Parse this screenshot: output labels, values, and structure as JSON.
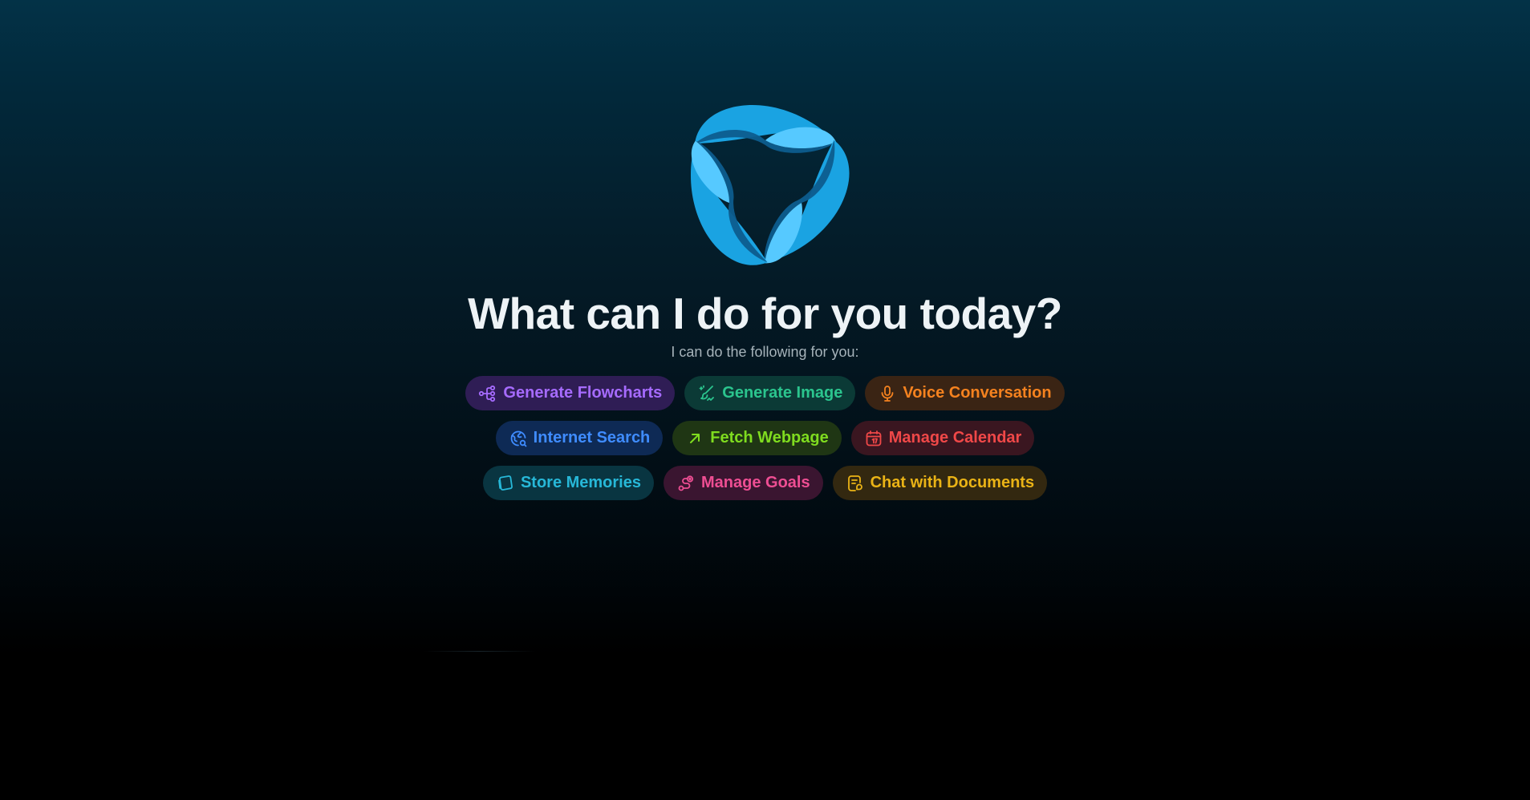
{
  "main": {
    "headline": "What can I do for you today?",
    "subtitle": "I can do the following for you:"
  },
  "chips": [
    {
      "label": "Generate Flowcharts",
      "icon": "flowchart-icon",
      "color": "#a66bff",
      "bg": "#2f1d55"
    },
    {
      "label": "Generate Image",
      "icon": "image-brush-icon",
      "color": "#2bc58e",
      "bg": "#0b3a36"
    },
    {
      "label": "Voice Conversation",
      "icon": "microphone-icon",
      "color": "#f5821f",
      "bg": "#3a2414"
    },
    {
      "label": "Internet Search",
      "icon": "globe-search-icon",
      "color": "#3f8cff",
      "bg": "#0e2a55"
    },
    {
      "label": "Fetch Webpage",
      "icon": "arrow-up-right-icon",
      "color": "#7fdc1f",
      "bg": "#1f3614"
    },
    {
      "label": "Manage Calendar",
      "icon": "calendar-icon",
      "color": "#f04848",
      "bg": "#3a1620"
    },
    {
      "label": "Store Memories",
      "icon": "memory-icon",
      "color": "#27b8d8",
      "bg": "#093541"
    },
    {
      "label": "Manage Goals",
      "icon": "goal-route-icon",
      "color": "#ee4e93",
      "bg": "#3a1530"
    },
    {
      "label": "Chat with Documents",
      "icon": "document-chat-icon",
      "color": "#eab316",
      "bg": "#332810"
    }
  ]
}
